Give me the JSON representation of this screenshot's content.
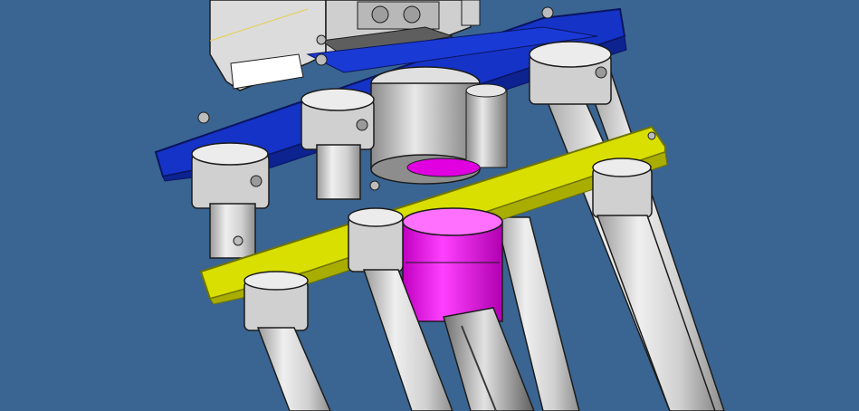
{
  "colors": {
    "background": "#3a6592",
    "top_plate": "#1533c6",
    "lower_plate": "#d9df00",
    "coupling": "#e000e0",
    "rod": "#d8d8d8",
    "steel": "#c4c4c4",
    "outline": "#1c1c1c",
    "sketch_line": "#e6d04a"
  },
  "components": [
    {
      "id": "motor-housing",
      "icon": "gearmotor-housing"
    },
    {
      "id": "top-mounting-plate",
      "icon": "blue-plate"
    },
    {
      "id": "flange-bearing",
      "icon": "bearing-housing"
    },
    {
      "id": "lower-mounting-plate",
      "icon": "yellow-plate"
    },
    {
      "id": "shaft-coupling",
      "icon": "magenta-coupling"
    },
    {
      "id": "lead-screw",
      "icon": "threaded-rod"
    },
    {
      "id": "guide-rods",
      "icon": "linear-rods",
      "count": 5
    },
    {
      "id": "rod-clamp-collars",
      "icon": "shaft-collars",
      "count": 8
    }
  ]
}
